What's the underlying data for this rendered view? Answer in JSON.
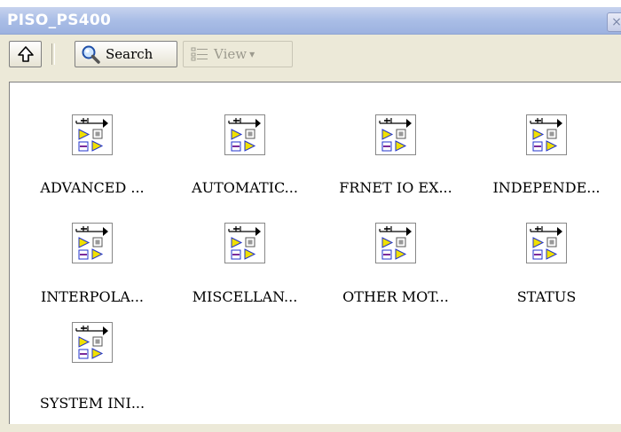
{
  "window": {
    "title": "PISO_PS400",
    "close_glyph": "×"
  },
  "toolbar": {
    "search_label": "Search",
    "view_label": "View",
    "view_arrow": "▾"
  },
  "items": [
    {
      "label": "ADVANCED ...",
      "icon": "vi-icon"
    },
    {
      "label": "AUTOMATIC...",
      "icon": "vi-icon"
    },
    {
      "label": "FRNET IO EX...",
      "icon": "vi-icon"
    },
    {
      "label": "INDEPENDE...",
      "icon": "vi-icon"
    },
    {
      "label": "INTERPOLA...",
      "icon": "vi-icon"
    },
    {
      "label": "MISCELLAN...",
      "icon": "vi-icon"
    },
    {
      "label": "OTHER MOT...",
      "icon": "vi-icon"
    },
    {
      "label": "STATUS",
      "icon": "vi-icon"
    },
    {
      "label": "SYSTEM INI...",
      "icon": "vi-icon"
    }
  ],
  "colors": {
    "titlebar": "#a9bde6",
    "chrome": "#ece9d8",
    "icon_yellow": "#f0e000",
    "icon_blue": "#2233cc"
  }
}
